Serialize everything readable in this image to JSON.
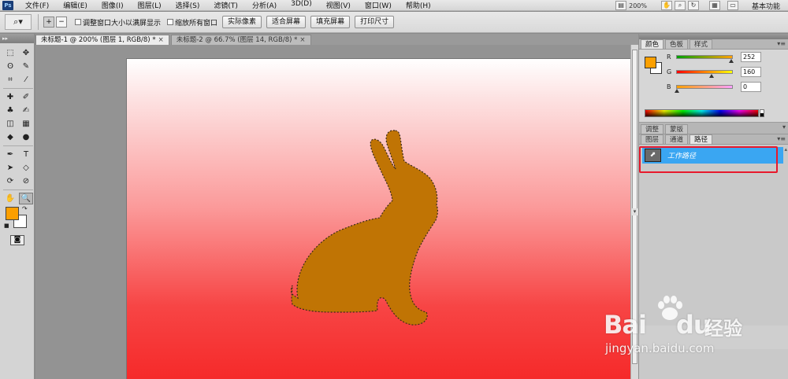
{
  "app": {
    "logo_text": "Ps"
  },
  "menu": [
    "文件(F)",
    "编辑(E)",
    "图像(I)",
    "图层(L)",
    "选择(S)",
    "滤镜(T)",
    "分析(A)",
    "3D(D)",
    "视图(V)",
    "窗口(W)",
    "帮助(H)"
  ],
  "menu_right": {
    "zoom": "200%",
    "workspace": "基本功能"
  },
  "options": {
    "checkbox_resize": "调整窗口大小以满屏显示",
    "checkbox_zoom_all": "缩放所有窗口",
    "btn_actual": "实际像素",
    "btn_fit": "适合屏幕",
    "btn_fill": "填充屏幕",
    "btn_print": "打印尺寸"
  },
  "doc_tabs": [
    {
      "label": "未标题-1 @ 200% (图层 1, RGB/8) *",
      "close": "×"
    },
    {
      "label": "未标题-2 @ 66.7% (图层 14, RGB/8) *",
      "close": "×"
    }
  ],
  "tools": [
    {
      "glyph": "⬚",
      "name": "marquee-tool-icon"
    },
    {
      "glyph": "✥",
      "name": "move-tool-icon"
    },
    {
      "glyph": "ʘ",
      "name": "lasso-tool-icon"
    },
    {
      "glyph": "✎",
      "name": "quick-select-tool-icon"
    },
    {
      "glyph": "⌗",
      "name": "crop-tool-icon"
    },
    {
      "glyph": "⁄",
      "name": "eyedropper-tool-icon"
    },
    {
      "glyph": "✚",
      "name": "healing-brush-tool-icon"
    },
    {
      "glyph": "✐",
      "name": "brush-tool-icon"
    },
    {
      "glyph": "♣",
      "name": "clone-stamp-tool-icon"
    },
    {
      "glyph": "✍",
      "name": "history-brush-tool-icon"
    },
    {
      "glyph": "◫",
      "name": "eraser-tool-icon"
    },
    {
      "glyph": "▦",
      "name": "gradient-tool-icon"
    },
    {
      "glyph": "◆",
      "name": "blur-tool-icon"
    },
    {
      "glyph": "●",
      "name": "dodge-tool-icon"
    },
    {
      "glyph": "✒",
      "name": "pen-tool-icon"
    },
    {
      "glyph": "T",
      "name": "type-tool-icon"
    },
    {
      "glyph": "➤",
      "name": "path-selection-tool-icon"
    },
    {
      "glyph": "◇",
      "name": "shape-tool-icon"
    },
    {
      "glyph": "⟳",
      "name": "3d-rotate-tool-icon"
    },
    {
      "glyph": "⊘",
      "name": "3d-orbit-tool-icon"
    },
    {
      "glyph": "✋",
      "name": "hand-tool-icon"
    },
    {
      "glyph": "🔍",
      "name": "zoom-tool-icon"
    }
  ],
  "toolbox": {
    "swap": "↷",
    "default": "■",
    "quickmask": "◙"
  },
  "color_panel": {
    "tabs": [
      "颜色",
      "色板",
      "样式"
    ],
    "channels": [
      {
        "label": "R",
        "value": "252",
        "level": 0.988,
        "gradient": "linear-gradient(to right, #00a000, #ffa000)"
      },
      {
        "label": "G",
        "value": "160",
        "level": 0.627,
        "gradient": "linear-gradient(to right, #fc0000, #fcff00)"
      },
      {
        "label": "B",
        "value": "0",
        "level": 0.0,
        "gradient": "linear-gradient(to right, #fca000, #fca0ff)"
      }
    ],
    "foreground": "#fca000",
    "background": "#ffffff"
  },
  "adj_tabs": [
    "调整",
    "蒙版"
  ],
  "paths_panel": {
    "tabs": [
      "图层",
      "通道",
      "路径"
    ],
    "path_name": "工作路径",
    "thumb": "⬈"
  },
  "canvas": {
    "gradient_top": "#ffffff",
    "gradient_bottom": "#f52626",
    "fill": "#c07404"
  },
  "watermark": {
    "brand": "Bai",
    "brand_suffix": "du",
    "text": "经验",
    "url": "jingyan.baidu.com"
  }
}
